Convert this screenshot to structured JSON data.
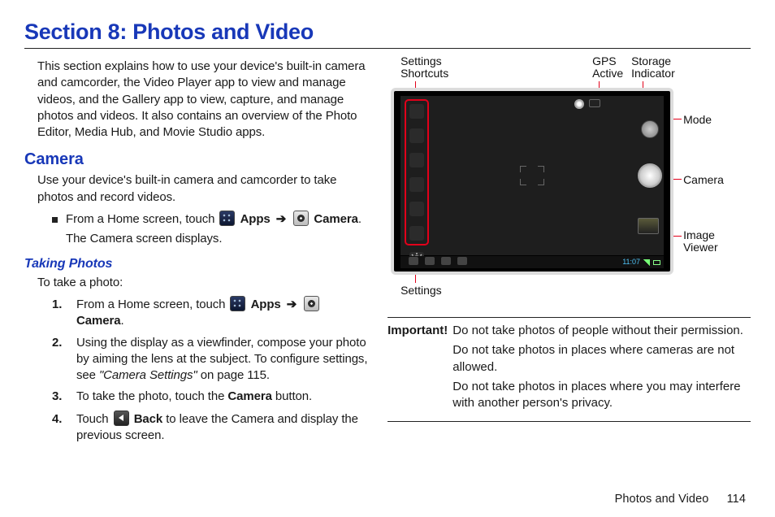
{
  "title": "Section 8: Photos and Video",
  "intro": "This section explains how to use your device's built-in camera and camcorder, the Video Player app to view and manage videos, and the Gallery app to view, capture, and manage photos and videos. It also contains an overview of the Photo Editor, Media Hub, and Movie Studio apps.",
  "camera": {
    "heading": "Camera",
    "desc": "Use your device's built-in camera and camcorder to take photos and record videos.",
    "bullet_pre": "From a Home screen, touch ",
    "apps_label": "Apps",
    "arrow": "➔",
    "camera_label": "Camera",
    "bullet_post": ".",
    "bullet_line2": "The Camera screen displays."
  },
  "taking": {
    "heading": "Taking Photos",
    "intro": "To take a photo:",
    "steps": [
      {
        "num": "1.",
        "pre": "From a Home screen, touch ",
        "apps": "Apps",
        "arrow": "➔",
        "cam": "Camera",
        "post": "."
      },
      {
        "num": "2.",
        "text": "Using the display as a viewfinder, compose your photo by aiming the lens at the subject. To configure settings, see ",
        "ref": "\"Camera Settings\"",
        "ref_post": " on page 115."
      },
      {
        "num": "3.",
        "pre": "To take the photo, touch the ",
        "bold": "Camera",
        "post": " button."
      },
      {
        "num": "4.",
        "pre": "Touch ",
        "bold": "Back",
        "post": " to leave the Camera and display the previous screen."
      }
    ]
  },
  "diagram": {
    "labels": {
      "settings_shortcuts": "Settings\nShortcuts",
      "gps": "GPS\nActive",
      "storage": "Storage\nIndicator",
      "mode": "Mode",
      "camera": "Camera",
      "viewer": "Image\nViewer",
      "settings": "Settings",
      "time": "11:07"
    }
  },
  "important": {
    "label": "Important!",
    "lines": [
      "Do not take photos of people without their permission.",
      "Do not take photos in places where cameras are not allowed.",
      "Do not take photos in places where you may interfere with another person's privacy."
    ]
  },
  "footer": {
    "section": "Photos and Video",
    "page": "114"
  }
}
